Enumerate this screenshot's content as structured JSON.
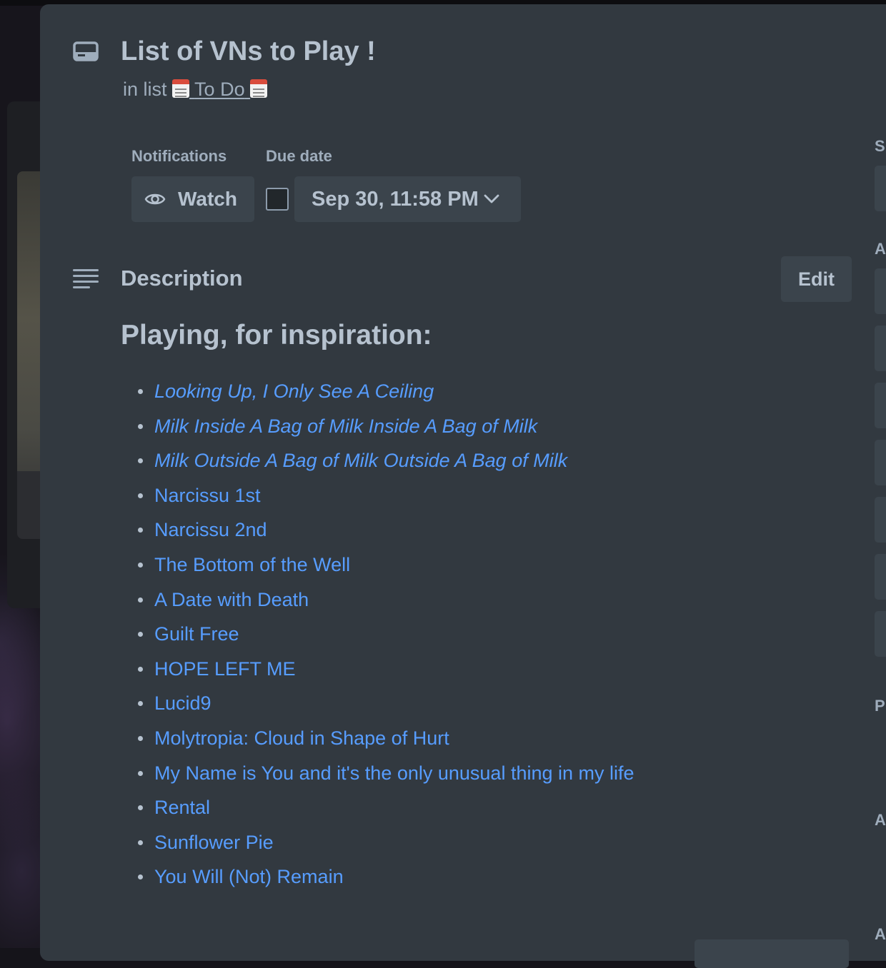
{
  "card": {
    "title": "List of VNs to Play !",
    "in_list_prefix": "in list",
    "list_name": "To Do"
  },
  "notifications": {
    "label": "Notifications",
    "watch_label": "Watch"
  },
  "due_date": {
    "label": "Due date",
    "value": "Sep 30, 11:58 PM",
    "checked": false
  },
  "description": {
    "title": "Description",
    "edit_label": "Edit",
    "heading": "Playing, for inspiration:",
    "items": [
      {
        "text": "Looking Up, I Only See A Ceiling",
        "italic": true
      },
      {
        "text": "Milk Inside A Bag of Milk Inside A Bag of Milk",
        "italic": true
      },
      {
        "text": "Milk Outside A Bag of Milk Outside A Bag of Milk",
        "italic": true
      },
      {
        "text": "Narcissu 1st",
        "italic": false
      },
      {
        "text": "Narcissu 2nd",
        "italic": false
      },
      {
        "text": "The Bottom of the Well",
        "italic": false
      },
      {
        "text": "A Date with Death",
        "italic": false
      },
      {
        "text": "Guilt Free",
        "italic": false
      },
      {
        "text": "HOPE LEFT ME",
        "italic": false
      },
      {
        "text": "Lucid9",
        "italic": false
      },
      {
        "text": "Molytropia: Cloud in Shape of Hurt",
        "italic": false
      },
      {
        "text": "My Name is You and it's the only unusual thing in my life",
        "italic": false
      },
      {
        "text": "Rental",
        "italic": false
      },
      {
        "text": "Sunflower Pie",
        "italic": false
      },
      {
        "text": "You Will (Not) Remain",
        "italic": false
      }
    ]
  },
  "sidebar": {
    "labels": [
      "S",
      "A",
      "P",
      "A",
      "A"
    ]
  },
  "colors": {
    "modal_bg": "#323940",
    "button_bg": "#3b444c",
    "text": "#b6c2cf",
    "link": "#579dff"
  },
  "icons": {
    "card": "card-icon",
    "watch": "eye-icon",
    "due_dropdown": "chevron-down-icon",
    "description": "description-lines-icon",
    "list_emoji": "calendar-emoji"
  }
}
